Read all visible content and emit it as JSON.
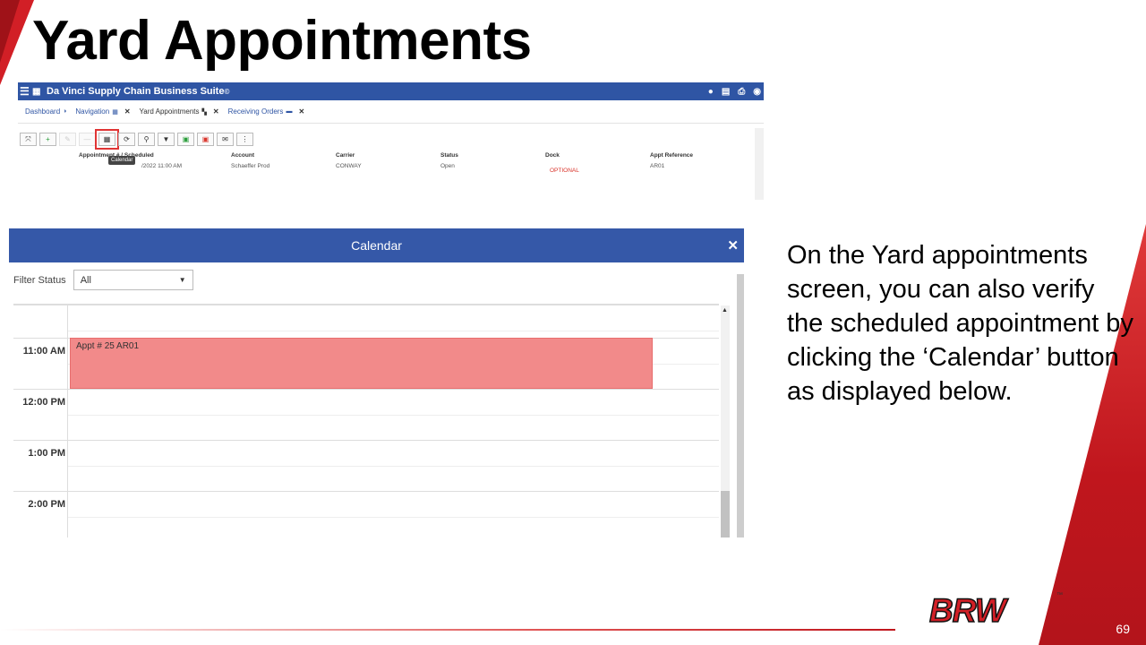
{
  "slide": {
    "title": "Yard Appointments",
    "body": "On the Yard appointments screen, you can also verify the scheduled appointment by clicking the ‘Calendar’ button as displayed below.",
    "page_number": "69",
    "logo_text": "BRW",
    "logo_tm": "™"
  },
  "app": {
    "title": "Da Vinci Supply Chain Business Suite",
    "title_mark": "©",
    "header_icons": [
      "user-icon",
      "warehouse-icon",
      "print-icon",
      "account-icon"
    ],
    "tabs": [
      {
        "label": "Dashboard",
        "icon": "dashboard-icon",
        "close": ""
      },
      {
        "label": "Navigation",
        "icon": "grid-icon",
        "close": "✕"
      },
      {
        "label": "Yard Appointments",
        "icon": "truck-icon",
        "close": "✕"
      },
      {
        "label": "Receiving Orders",
        "icon": "box-icon",
        "close": "✕"
      }
    ],
    "toolbar": [
      "expand-icon",
      "add-icon",
      "edit-icon",
      "remove-icon",
      "calendar-icon",
      "refresh-icon",
      "search-icon",
      "filter-icon",
      "excel-icon",
      "pdf-icon",
      "email-icon",
      "more-icon"
    ],
    "tooltip": "Calendar",
    "columns": [
      "Appointment # / Scheduled",
      "Account",
      "Carrier",
      "Status",
      "Dock",
      "Appt Reference"
    ],
    "rows": [
      {
        "scheduled": "/2022 11:00 AM",
        "account": "Schaeffer Prod",
        "carrier": "CONWAY",
        "status": "Open",
        "dock": "OPTIONAL",
        "reference": "AR01"
      }
    ]
  },
  "calendar": {
    "title": "Calendar",
    "close": "✕",
    "filter_label": "Filter Status",
    "filter_value": "All",
    "times": [
      "",
      "11:00 AM",
      "12:00 PM",
      "1:00 PM",
      "2:00 PM"
    ],
    "event": {
      "label": "Appt # 25 AR01",
      "color": "#f28a8a",
      "time": "11:00 AM"
    }
  },
  "colors": {
    "brand_red": "#d21f26",
    "app_blue": "#2f55a4"
  }
}
